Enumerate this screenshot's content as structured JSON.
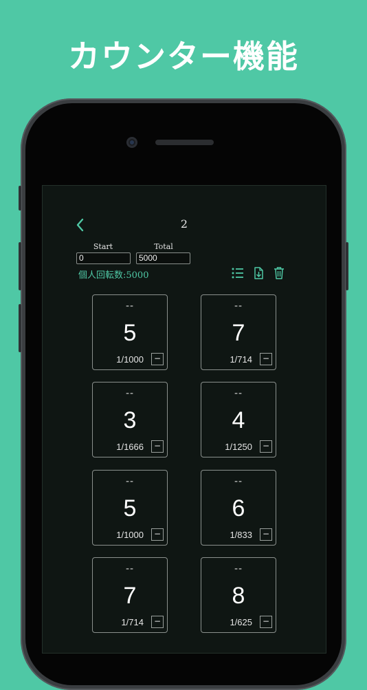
{
  "headline": "カウンター機能",
  "nav": {
    "back_icon": "chevron-left-icon",
    "title": "2"
  },
  "fields": {
    "start_label": "Start",
    "start_value": "0",
    "total_label": "Total",
    "total_value": "5000"
  },
  "spin_count": "個人回転数:5000",
  "toolbar": {
    "list_icon": "list-icon",
    "export_icon": "file-download-icon",
    "delete_icon": "trash-icon"
  },
  "accent_color": "#4fc8a5",
  "counters": [
    {
      "dash": "--",
      "count": "5",
      "ratio": "1/1000",
      "minus": "−"
    },
    {
      "dash": "--",
      "count": "7",
      "ratio": "1/714",
      "minus": "−"
    },
    {
      "dash": "--",
      "count": "3",
      "ratio": "1/1666",
      "minus": "−"
    },
    {
      "dash": "--",
      "count": "4",
      "ratio": "1/1250",
      "minus": "−"
    },
    {
      "dash": "--",
      "count": "5",
      "ratio": "1/1000",
      "minus": "−"
    },
    {
      "dash": "--",
      "count": "6",
      "ratio": "1/833",
      "minus": "−"
    },
    {
      "dash": "--",
      "count": "7",
      "ratio": "1/714",
      "minus": "−"
    },
    {
      "dash": "--",
      "count": "8",
      "ratio": "1/625",
      "minus": "−"
    }
  ]
}
